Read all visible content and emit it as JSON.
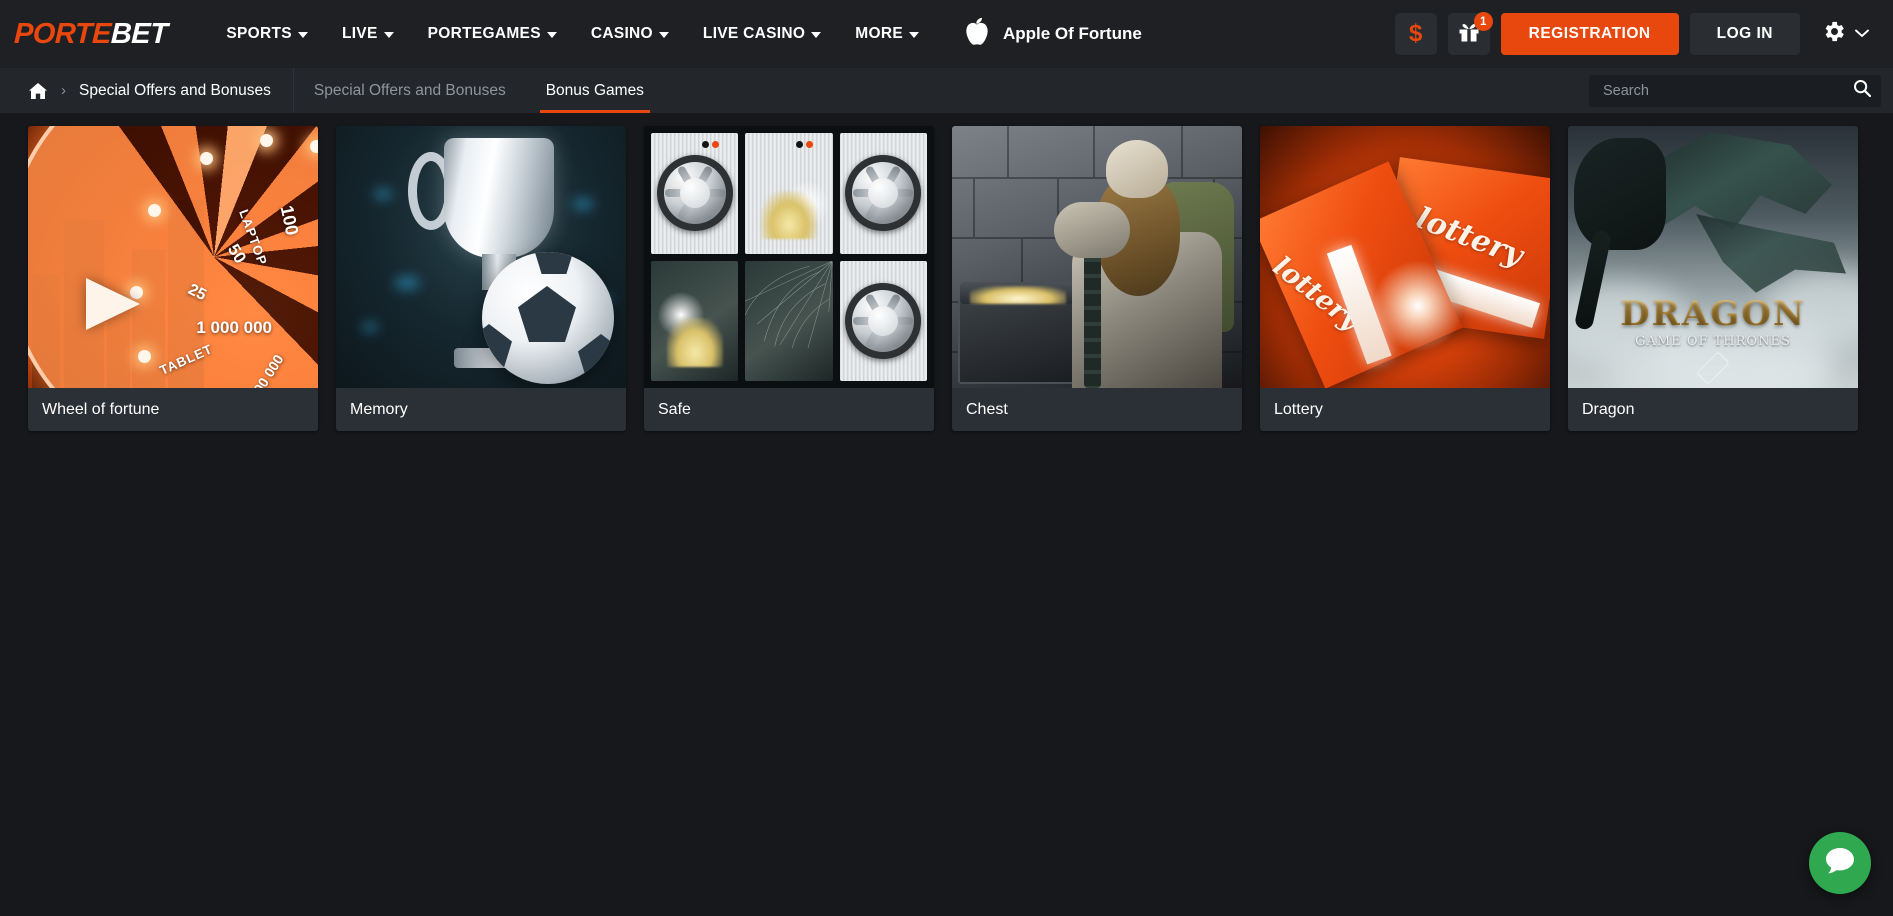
{
  "brand": {
    "logo_orange": "PORTE",
    "logo_white": "BET",
    "accent_color": "#e8470d",
    "header_bg": "#1e2024",
    "page_bg": "#16181c",
    "card_bg": "#2b2f36",
    "chat_color": "#2fa84f"
  },
  "nav": {
    "items": [
      {
        "label": "SPORTS",
        "has_caret": true,
        "icon": "chevron-down-icon"
      },
      {
        "label": "LIVE",
        "has_caret": true,
        "icon": "chevron-down-icon"
      },
      {
        "label": "PORTEGAMES",
        "has_caret": true,
        "icon": "chevron-down-icon"
      },
      {
        "label": "CASINO",
        "has_caret": true,
        "icon": "chevron-down-icon"
      },
      {
        "label": "LIVE CASINO",
        "has_caret": true,
        "icon": "chevron-down-icon"
      },
      {
        "label": "MORE",
        "has_caret": true,
        "icon": "chevron-down-icon"
      }
    ]
  },
  "promo": {
    "icon": "apple-icon",
    "title": "Apple Of Fortune"
  },
  "header_actions": {
    "deposit_icon": "dollar-icon",
    "deposit_symbol": "$",
    "gift_icon": "gift-icon",
    "gift_badge": "1",
    "register_label": "REGISTRATION",
    "login_label": "LOG IN",
    "settings_icon": "gear-icon",
    "settings_caret_icon": "chevron-down-icon"
  },
  "breadcrumb": {
    "home_icon": "home-icon",
    "separator": "›",
    "current": "Special Offers and Bonuses"
  },
  "tabs": [
    {
      "label": "Special Offers and Bonuses",
      "active": false
    },
    {
      "label": "Bonus Games",
      "active": true
    }
  ],
  "search": {
    "placeholder": "Search",
    "value": "",
    "icon": "search-icon"
  },
  "games": [
    {
      "id": "wheel-of-fortune",
      "title": "Wheel of fortune",
      "art": "wheel",
      "art_labels": [
        "100",
        "50",
        "25",
        "1 000 000",
        "LAPTOP",
        "TABLET",
        "00 000"
      ]
    },
    {
      "id": "memory",
      "title": "Memory",
      "art": "memory",
      "art_labels": []
    },
    {
      "id": "safe",
      "title": "Safe",
      "art": "safe",
      "art_labels": []
    },
    {
      "id": "chest",
      "title": "Chest",
      "art": "chest",
      "art_labels": []
    },
    {
      "id": "lottery",
      "title": "Lottery",
      "art": "lottery",
      "art_labels": [
        "lottery",
        "lottery"
      ]
    },
    {
      "id": "dragon",
      "title": "Dragon",
      "art": "dragon",
      "art_labels": [
        "DRAGON",
        "GAME OF THRONES"
      ]
    }
  ],
  "chat": {
    "icon": "chat-bubble-icon",
    "label": "Live chat"
  }
}
